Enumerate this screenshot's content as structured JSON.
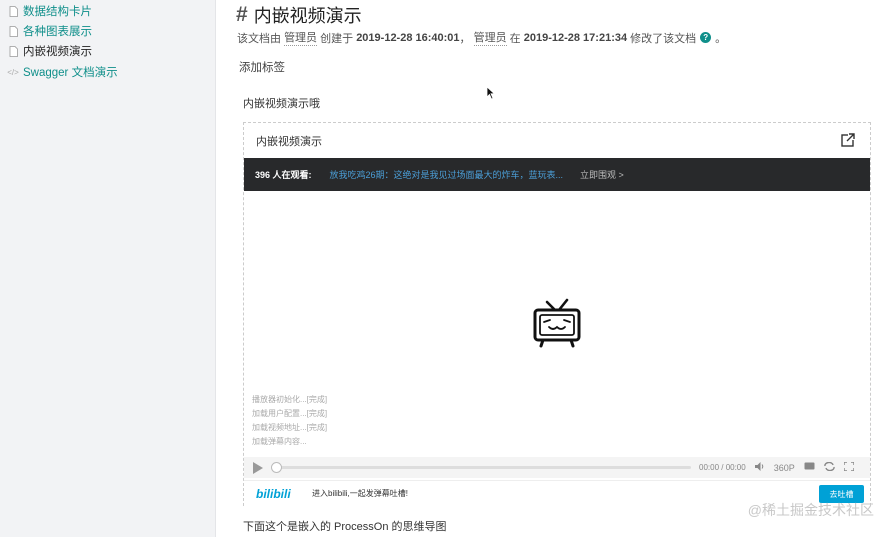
{
  "sidebar": {
    "items": [
      {
        "label": "数据结构卡片",
        "icon": "document-icon",
        "active": false
      },
      {
        "label": "各种图表展示",
        "icon": "document-icon",
        "active": false
      },
      {
        "label": "内嵌视频演示",
        "icon": "document-icon",
        "active": true
      },
      {
        "label": "Swagger 文档演示",
        "icon": "code-icon",
        "active": false
      }
    ]
  },
  "page": {
    "hash": "#",
    "title": "内嵌视频演示",
    "meta": {
      "prefix": "该文档由",
      "creator": "管理员",
      "created_text": "创建于",
      "created_at": "2019-12-28 16:40:01",
      "sep": "，",
      "editor": "管理员",
      "at_text": "在",
      "updated_at": "2019-12-28 17:21:34",
      "updated_text": "修改了该文档",
      "end": "。"
    },
    "add_tag": "添加标签",
    "intro": "内嵌视频演示哦",
    "after_text": "下面这个是嵌入的 ProcessOn 的思维导图"
  },
  "embed": {
    "title": "内嵌视频演示",
    "watching": "396 人在观看:",
    "headline": "放我吃鸡26期：这绝对是我见过场面最大的炸车，蓝玩表...",
    "jump": "立即围观 >",
    "logs": [
      "播放器初始化...[完成]",
      "加载用户配置...[完成]",
      "加载视频地址...[完成]",
      "加载弹幕内容..."
    ],
    "time": "00:00 / 00:00",
    "quality": "360P",
    "logo": "bilibili",
    "danmaku_prompt": "进入bilibili,一起发弹幕吐槽!",
    "send_label": "去吐槽"
  },
  "watermark": "@稀土掘金技术社区",
  "colors": {
    "accent": "#0f8f8a",
    "bili_blue": "#00a1d6",
    "dark_bar": "#28292b"
  }
}
